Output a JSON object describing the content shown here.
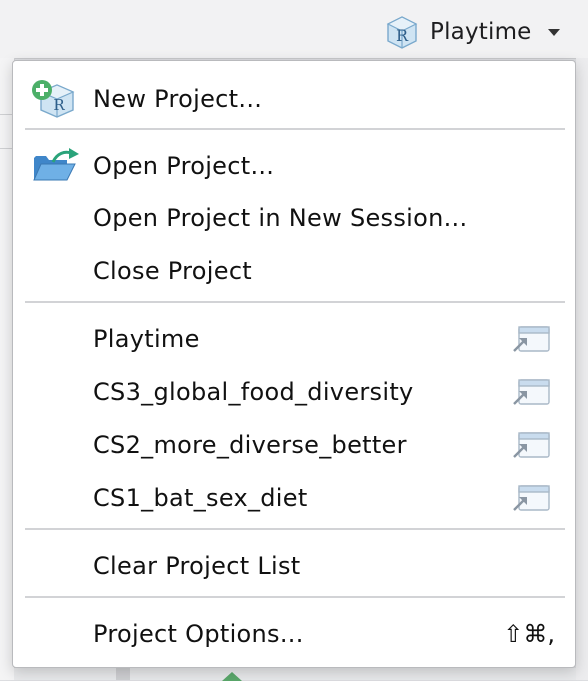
{
  "header": {
    "project_name": "Playtime",
    "project_icon": "r-project-cube-icon"
  },
  "menu": {
    "new_project": {
      "label": "New Project...",
      "icon": "new-project-icon"
    },
    "open_project": {
      "label": "Open Project...",
      "icon": "open-folder-icon"
    },
    "open_new_session": {
      "label": "Open Project in New Session..."
    },
    "close_project": {
      "label": "Close Project"
    },
    "recent_projects": [
      {
        "label": "Playtime",
        "icon": "open-in-new-window-icon"
      },
      {
        "label": "CS3_global_food_diversity",
        "icon": "open-in-new-window-icon"
      },
      {
        "label": "CS2_more_diverse_better",
        "icon": "open-in-new-window-icon"
      },
      {
        "label": "CS1_bat_sex_diet",
        "icon": "open-in-new-window-icon"
      }
    ],
    "clear_list": {
      "label": "Clear Project List"
    },
    "project_options": {
      "label": "Project Options...",
      "shortcut": "⇧⌘,"
    }
  },
  "colors": {
    "menu_background": "#ffffff",
    "separator": "#d2d3d6",
    "green_plus": "#4caf68",
    "folder_blue": "#3f86c9",
    "arrow_teal": "#2aa37a",
    "cube_blue": "#8fbfe0"
  }
}
